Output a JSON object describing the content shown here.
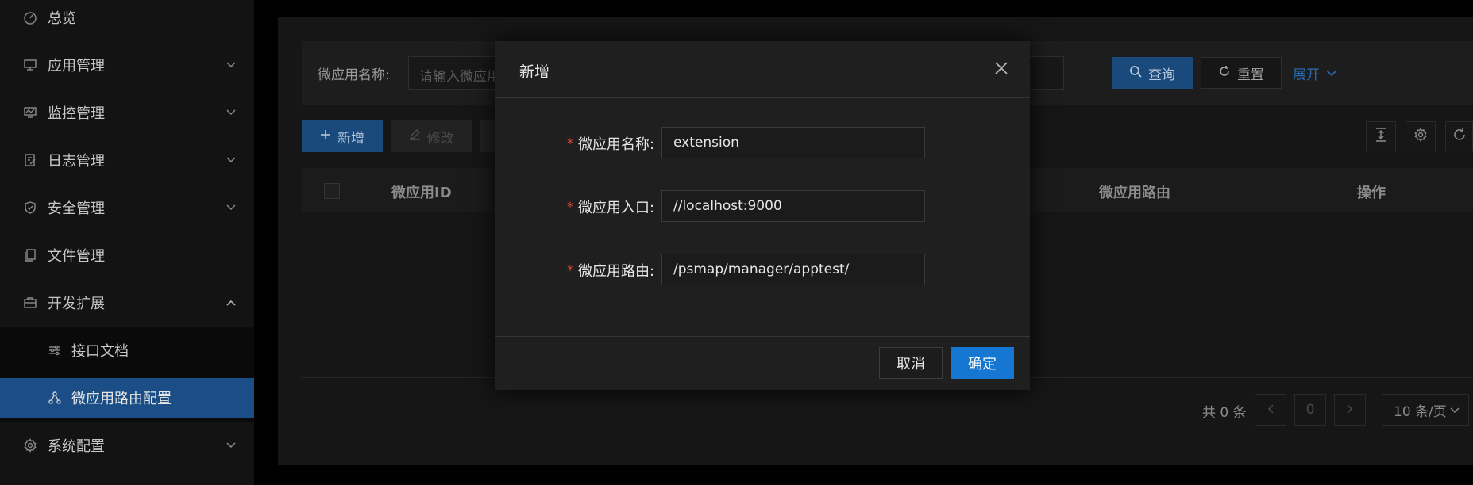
{
  "sidebar": {
    "items": [
      {
        "label": "总览",
        "icon": "dashboard-icon"
      },
      {
        "label": "应用管理",
        "icon": "monitor-icon"
      },
      {
        "label": "监控管理",
        "icon": "chart-monitor-icon"
      },
      {
        "label": "日志管理",
        "icon": "edit-doc-icon"
      },
      {
        "label": "安全管理",
        "icon": "shield-icon"
      },
      {
        "label": "文件管理",
        "icon": "files-icon"
      },
      {
        "label": "开发扩展",
        "icon": "briefcase-icon"
      },
      {
        "label": "接口文档",
        "icon": "sliders-icon"
      },
      {
        "label": "微应用路由配置",
        "icon": "share-nodes-icon"
      },
      {
        "label": "系统配置",
        "icon": "gear-icon"
      }
    ]
  },
  "query": {
    "label": "微应用名称:",
    "placeholder": "请输入微应用",
    "search_label": "查询",
    "reset_label": "重置",
    "expand_label": "展开"
  },
  "toolbar": {
    "add_label": "新增",
    "edit_label": "修改"
  },
  "table": {
    "columns": [
      "微应用ID",
      "微应用路由",
      "操作"
    ]
  },
  "pagination": {
    "total": "共 0 条",
    "current_page": "0",
    "page_size": "10 条/页"
  },
  "modal": {
    "title": "新增",
    "fields": [
      {
        "label": "微应用名称:",
        "value": "extension"
      },
      {
        "label": "微应用入口:",
        "value": "//localhost:9000"
      },
      {
        "label": "微应用路由:",
        "value": "/psmap/manager/apptest/"
      }
    ],
    "cancel_label": "取消",
    "ok_label": "确定"
  },
  "colors": {
    "accent": "#1677d2",
    "active_menu": "#1b4e86",
    "required": "#d84a3a"
  }
}
